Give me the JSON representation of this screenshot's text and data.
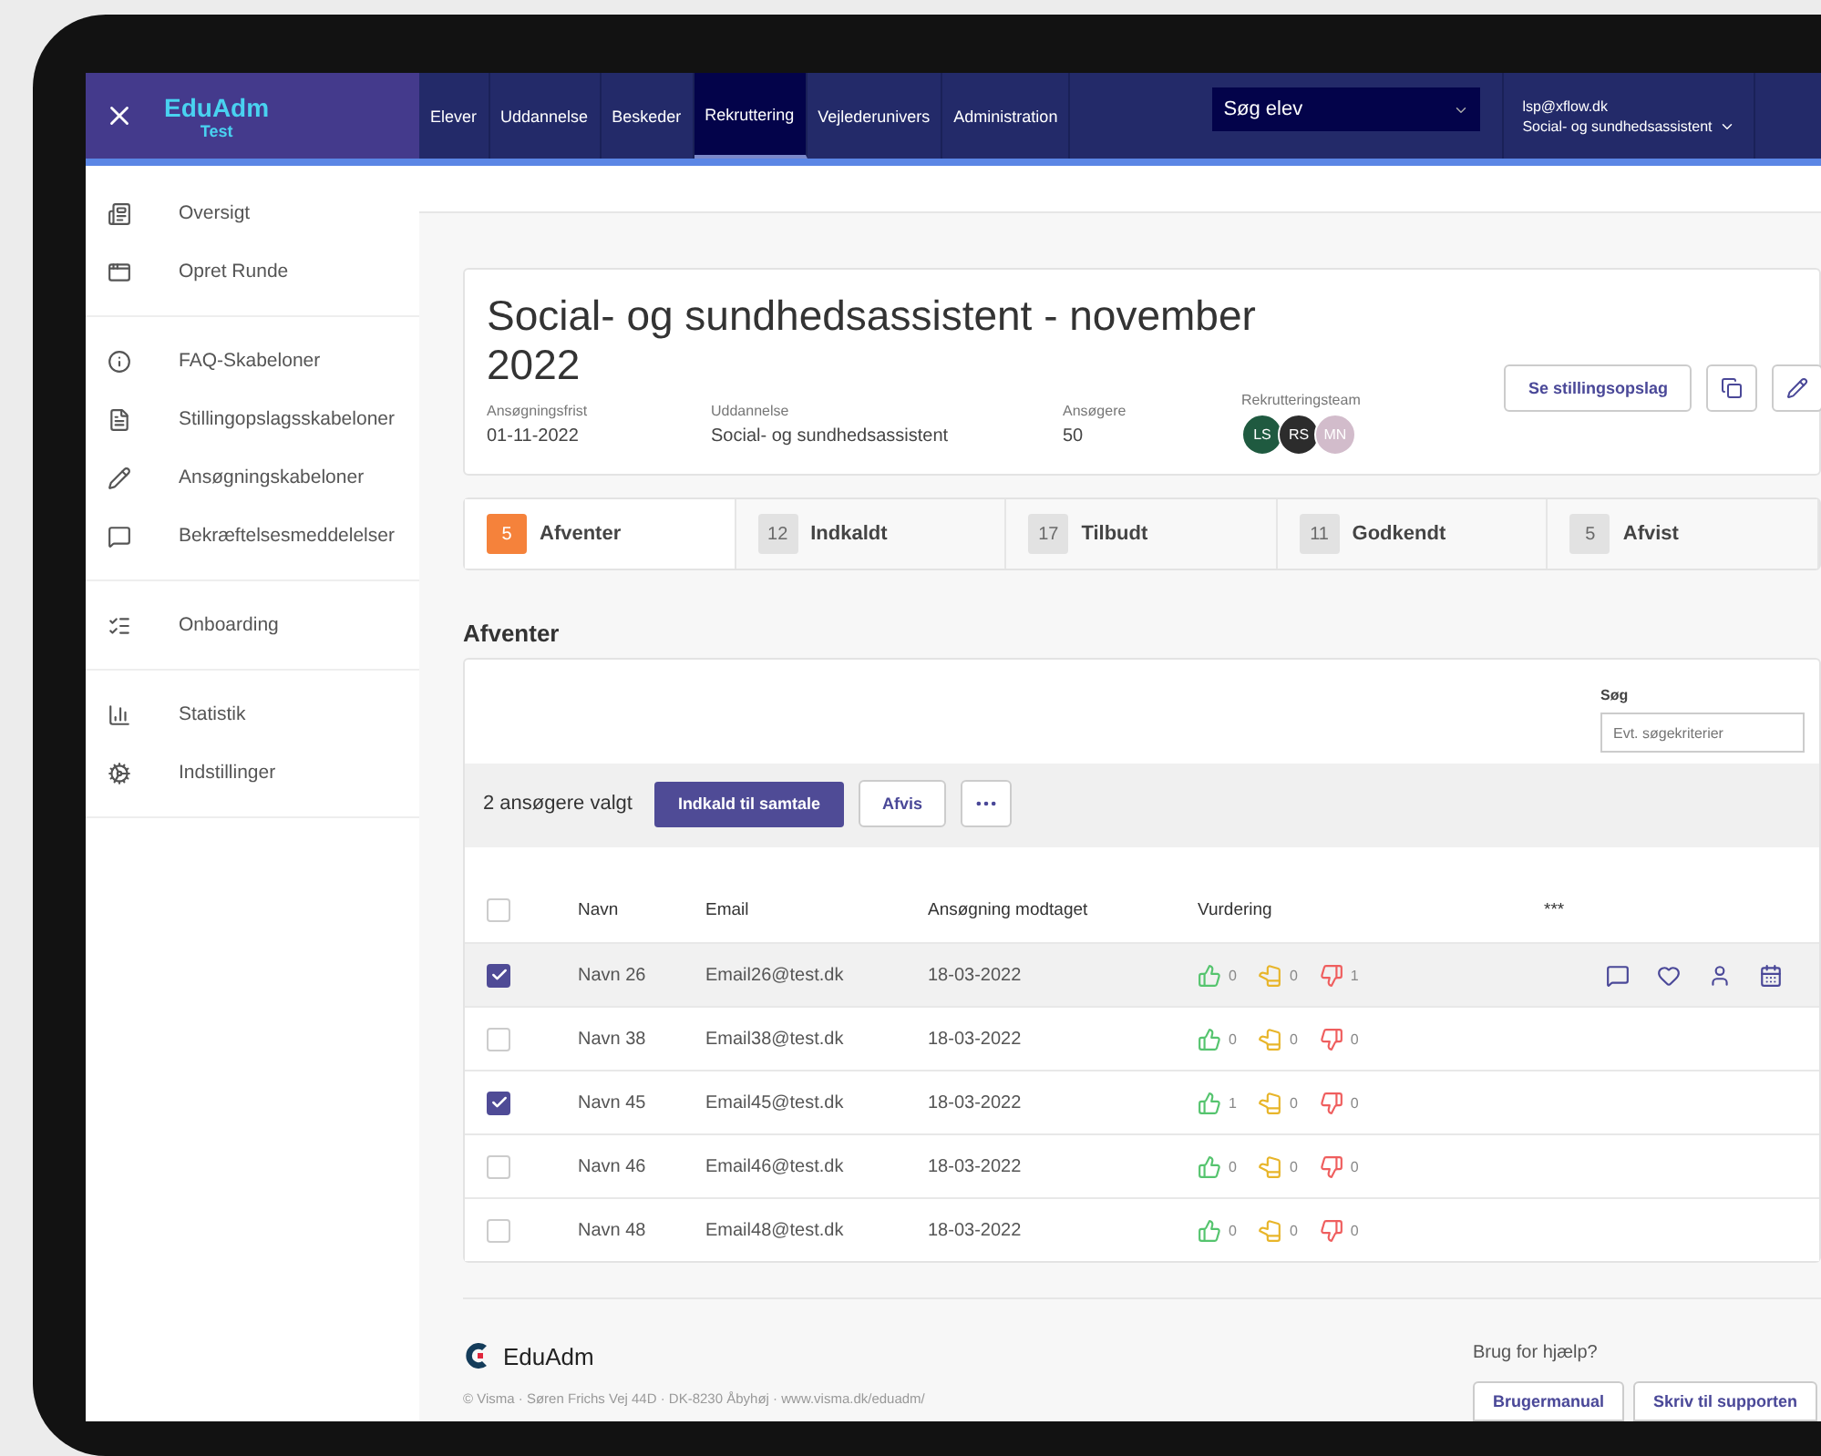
{
  "header": {
    "brand": "EduAdm",
    "environment": "Test",
    "nav": [
      {
        "label": "Elever",
        "selected": false
      },
      {
        "label": "Uddannelse",
        "selected": false
      },
      {
        "label": "Beskeder",
        "selected": false
      },
      {
        "label": "Rekruttering",
        "selected": true
      },
      {
        "label": "Vejlederunivers",
        "selected": false
      },
      {
        "label": "Administration",
        "selected": false
      }
    ],
    "student_search": {
      "value": "Søg elev"
    },
    "user": {
      "email": "lsp@xflow.dk",
      "role": "Social- og sundhedsassistent"
    }
  },
  "sidebar": {
    "groups": [
      [
        "Oversigt",
        "Opret Runde"
      ],
      [
        "FAQ-Skabeloner",
        "Stillingopslagsskabeloner",
        "Ansøgningskabeloner",
        "Bekræftelsesmeddelelser"
      ],
      [
        "Onboarding"
      ],
      [
        "Statistik",
        "Indstillinger"
      ]
    ]
  },
  "job": {
    "title": "Social- og sundhedsassistent - november 2022",
    "fields": [
      {
        "label": "Ansøgningsfrist",
        "value": "01-11-2022"
      },
      {
        "label": "Uddannelse",
        "value": "Social- og sundhedsassistent"
      },
      {
        "label": "Ansøgere",
        "value": "50"
      }
    ],
    "team": {
      "label": "Rekrutteringsteam",
      "members": [
        {
          "initials": "LS",
          "color": "#1f5a40"
        },
        {
          "initials": "RS",
          "color": "#2c2c2c"
        },
        {
          "initials": "MN",
          "color": "#d2bccb"
        }
      ]
    },
    "view_button": "Se stillingsopslag"
  },
  "stages": [
    {
      "count": "5",
      "label": "Afventer",
      "selected": true
    },
    {
      "count": "12",
      "label": "Indkaldt",
      "selected": false
    },
    {
      "count": "17",
      "label": "Tilbudt",
      "selected": false
    },
    {
      "count": "11",
      "label": "Godkendt",
      "selected": false
    },
    {
      "count": "5",
      "label": "Afvist",
      "selected": false
    }
  ],
  "section_title": "Afventer",
  "search": {
    "label": "Søg",
    "placeholder": "Evt. søgekriterier"
  },
  "bulk": {
    "text": "2 ansøgere valgt",
    "primary": "Indkald til samtale",
    "secondary": "Afvis"
  },
  "table": {
    "columns": [
      "Navn",
      "Email",
      "Ansøgning modtaget",
      "Vurdering",
      "***"
    ],
    "header_checked": false,
    "rows": [
      {
        "checked": true,
        "hovered": true,
        "name": "Navn 26",
        "email": "Email26@test.dk",
        "date": "18-03-2022",
        "up": "0",
        "neutral": "0",
        "down": "1"
      },
      {
        "checked": false,
        "hovered": false,
        "name": "Navn 38",
        "email": "Email38@test.dk",
        "date": "18-03-2022",
        "up": "0",
        "neutral": "0",
        "down": "0"
      },
      {
        "checked": true,
        "hovered": false,
        "name": "Navn 45",
        "email": "Email45@test.dk",
        "date": "18-03-2022",
        "up": "1",
        "neutral": "0",
        "down": "0"
      },
      {
        "checked": false,
        "hovered": false,
        "name": "Navn 46",
        "email": "Email46@test.dk",
        "date": "18-03-2022",
        "up": "0",
        "neutral": "0",
        "down": "0"
      },
      {
        "checked": false,
        "hovered": false,
        "name": "Navn 48",
        "email": "Email48@test.dk",
        "date": "18-03-2022",
        "up": "0",
        "neutral": "0",
        "down": "0"
      }
    ]
  },
  "footer": {
    "brand": "EduAdm",
    "address": "© Visma · Søren Frichs Vej 44D · DK-8230 Åbyhøj · www.visma.dk/eduadm/",
    "help": "Brug for hjælp?",
    "buttons": [
      "Brugermanual",
      "Skriv til supporten"
    ]
  }
}
